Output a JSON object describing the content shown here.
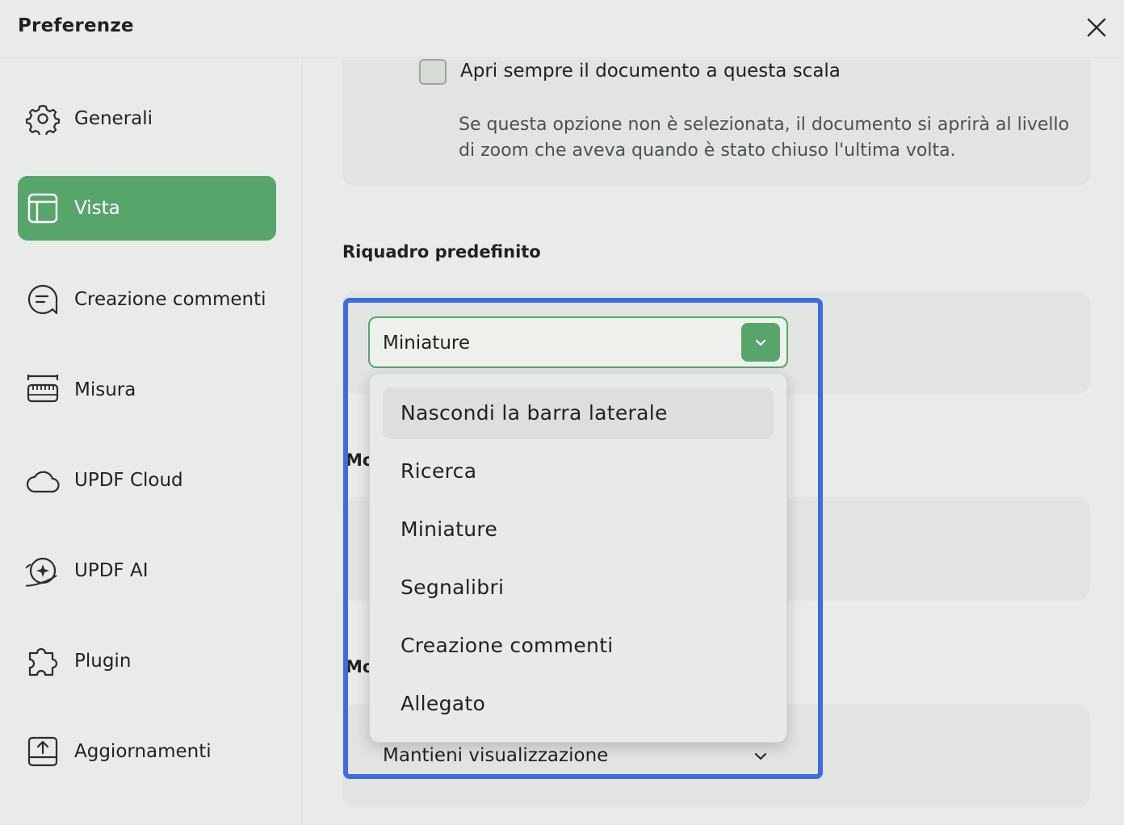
{
  "window": {
    "title": "Preferenze"
  },
  "sidebar": {
    "items": [
      {
        "label": "Generali",
        "icon": "gear-icon"
      },
      {
        "label": "Vista",
        "icon": "layout-icon",
        "active": true
      },
      {
        "label": "Creazione commenti",
        "icon": "comment-icon"
      },
      {
        "label": "Misura",
        "icon": "ruler-icon"
      },
      {
        "label": "UPDF Cloud",
        "icon": "cloud-icon"
      },
      {
        "label": "UPDF AI",
        "icon": "ai-sparkle-icon"
      },
      {
        "label": "Plugin",
        "icon": "puzzle-icon"
      },
      {
        "label": "Aggiornamenti",
        "icon": "update-icon"
      }
    ]
  },
  "main": {
    "scale_checkbox": {
      "label": "Apri sempre il documento a questa scala",
      "checked": false,
      "help": "Se questa opzione non è selezionata, il documento si aprirà al livello di zoom che aveva quando è stato chiuso l'ultima volta."
    },
    "default_pane": {
      "heading": "Riquadro predefinito",
      "selected": "Miniature",
      "options": [
        "Nascondi la barra laterale",
        "Ricerca",
        "Miniature",
        "Segnalibri",
        "Creazione commenti",
        "Allegato"
      ],
      "hovered_index": 0
    },
    "hidden_heading_1": "Mo",
    "hidden_heading_2": "Mo",
    "view_mode_select": {
      "selected": "Mantieni visualizzazione"
    }
  },
  "colors": {
    "accent": "#58a56c",
    "highlight": "#3f6be0",
    "background": "#e8ebe7",
    "card": "#e1e4e0"
  }
}
